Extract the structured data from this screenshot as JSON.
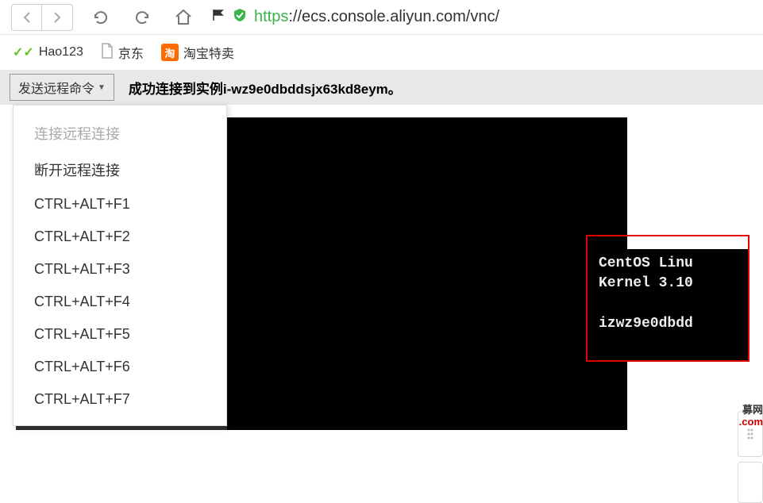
{
  "browser": {
    "url_protocol": "https",
    "url_rest": "://ecs.console.aliyun.com/vnc/"
  },
  "bookmarks": {
    "hao123": "Hao123",
    "jd": "京东",
    "taobao_icon": "淘",
    "taobao": "淘宝特卖"
  },
  "cmdbar": {
    "button_label": "发送远程命令",
    "status_prefix": "成功连接到实例",
    "instance_id": "i-wz9e0dbddsjx63kd8eym。"
  },
  "menu": {
    "items": [
      {
        "label": "连接远程连接",
        "disabled": true
      },
      {
        "label": "断开远程连接",
        "disabled": false
      },
      {
        "label": "CTRL+ALT+F1",
        "disabled": false
      },
      {
        "label": "CTRL+ALT+F2",
        "disabled": false
      },
      {
        "label": "CTRL+ALT+F3",
        "disabled": false
      },
      {
        "label": "CTRL+ALT+F4",
        "disabled": false
      },
      {
        "label": "CTRL+ALT+F5",
        "disabled": false
      },
      {
        "label": "CTRL+ALT+F6",
        "disabled": false
      },
      {
        "label": "CTRL+ALT+F7",
        "disabled": false
      }
    ]
  },
  "terminal": {
    "line1": "CentOS Linu",
    "line2": "Kernel 3.10",
    "line3": "izwz9e0dbdd"
  },
  "corner": {
    "text1": "募网",
    "text2": ".com"
  }
}
